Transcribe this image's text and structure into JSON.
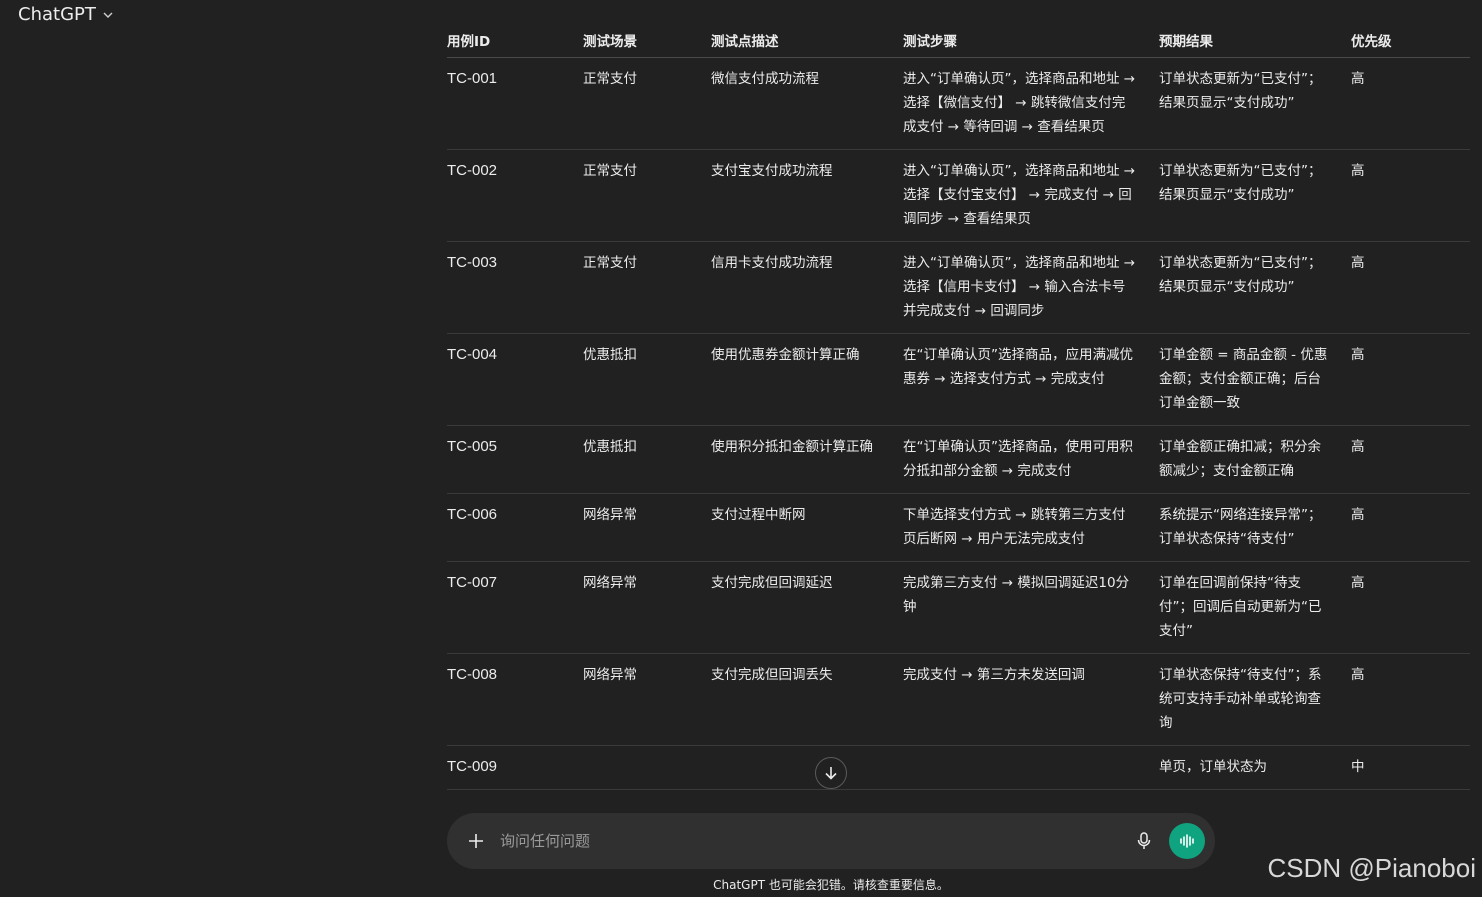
{
  "header": {
    "title": "ChatGPT"
  },
  "table": {
    "headers": [
      "用例ID",
      "测试场景",
      "测试点描述",
      "测试步骤",
      "预期结果",
      "优先级"
    ],
    "rows": [
      [
        "TC-001",
        "正常支付",
        "微信支付成功流程",
        "进入“订单确认页”，选择商品和地址 → 选择【微信支付】 → 跳转微信支付完成支付 → 等待回调 → 查看结果页",
        "订单状态更新为“已支付”；结果页显示“支付成功”",
        "高"
      ],
      [
        "TC-002",
        "正常支付",
        "支付宝支付成功流程",
        "进入“订单确认页”，选择商品和地址 → 选择【支付宝支付】 → 完成支付 → 回调同步 → 查看结果页",
        "订单状态更新为“已支付”；结果页显示“支付成功”",
        "高"
      ],
      [
        "TC-003",
        "正常支付",
        "信用卡支付成功流程",
        "进入“订单确认页”，选择商品和地址 → 选择【信用卡支付】 → 输入合法卡号并完成支付 → 回调同步",
        "订单状态更新为“已支付”；结果页显示“支付成功”",
        "高"
      ],
      [
        "TC-004",
        "优惠抵扣",
        "使用优惠券金额计算正确",
        "在“订单确认页”选择商品，应用满减优惠券 → 选择支付方式 → 完成支付",
        "订单金额 = 商品金额 - 优惠金额；支付金额正确；后台订单金额一致",
        "高"
      ],
      [
        "TC-005",
        "优惠抵扣",
        "使用积分抵扣金额计算正确",
        "在“订单确认页”选择商品，使用可用积分抵扣部分金额 → 完成支付",
        "订单金额正确扣减；积分余额减少；支付金额正确",
        "高"
      ],
      [
        "TC-006",
        "网络异常",
        "支付过程中断网",
        "下单选择支付方式 → 跳转第三方支付页后断网 → 用户无法完成支付",
        "系统提示“网络连接异常”；订单状态保持“待支付”",
        "高"
      ],
      [
        "TC-007",
        "网络异常",
        "支付完成但回调延迟",
        "完成第三方支付 → 模拟回调延迟10分钟",
        "订单在回调前保持“待支付”；回调后自动更新为“已支付”",
        "高"
      ],
      [
        "TC-008",
        "网络异常",
        "支付完成但回调丢失",
        "完成支付 → 第三方未发送回调",
        "订单状态保持“待支付”；系统可支持手动补单或轮询查询",
        "高"
      ],
      [
        "TC-009",
        "",
        "",
        "",
        "单页，订单状态为",
        "中"
      ]
    ]
  },
  "composer": {
    "placeholder": "询问任何问题"
  },
  "disclaimer": "ChatGPT 也可能会犯错。请核查重要信息。",
  "watermark": "CSDN @Pianoboi"
}
